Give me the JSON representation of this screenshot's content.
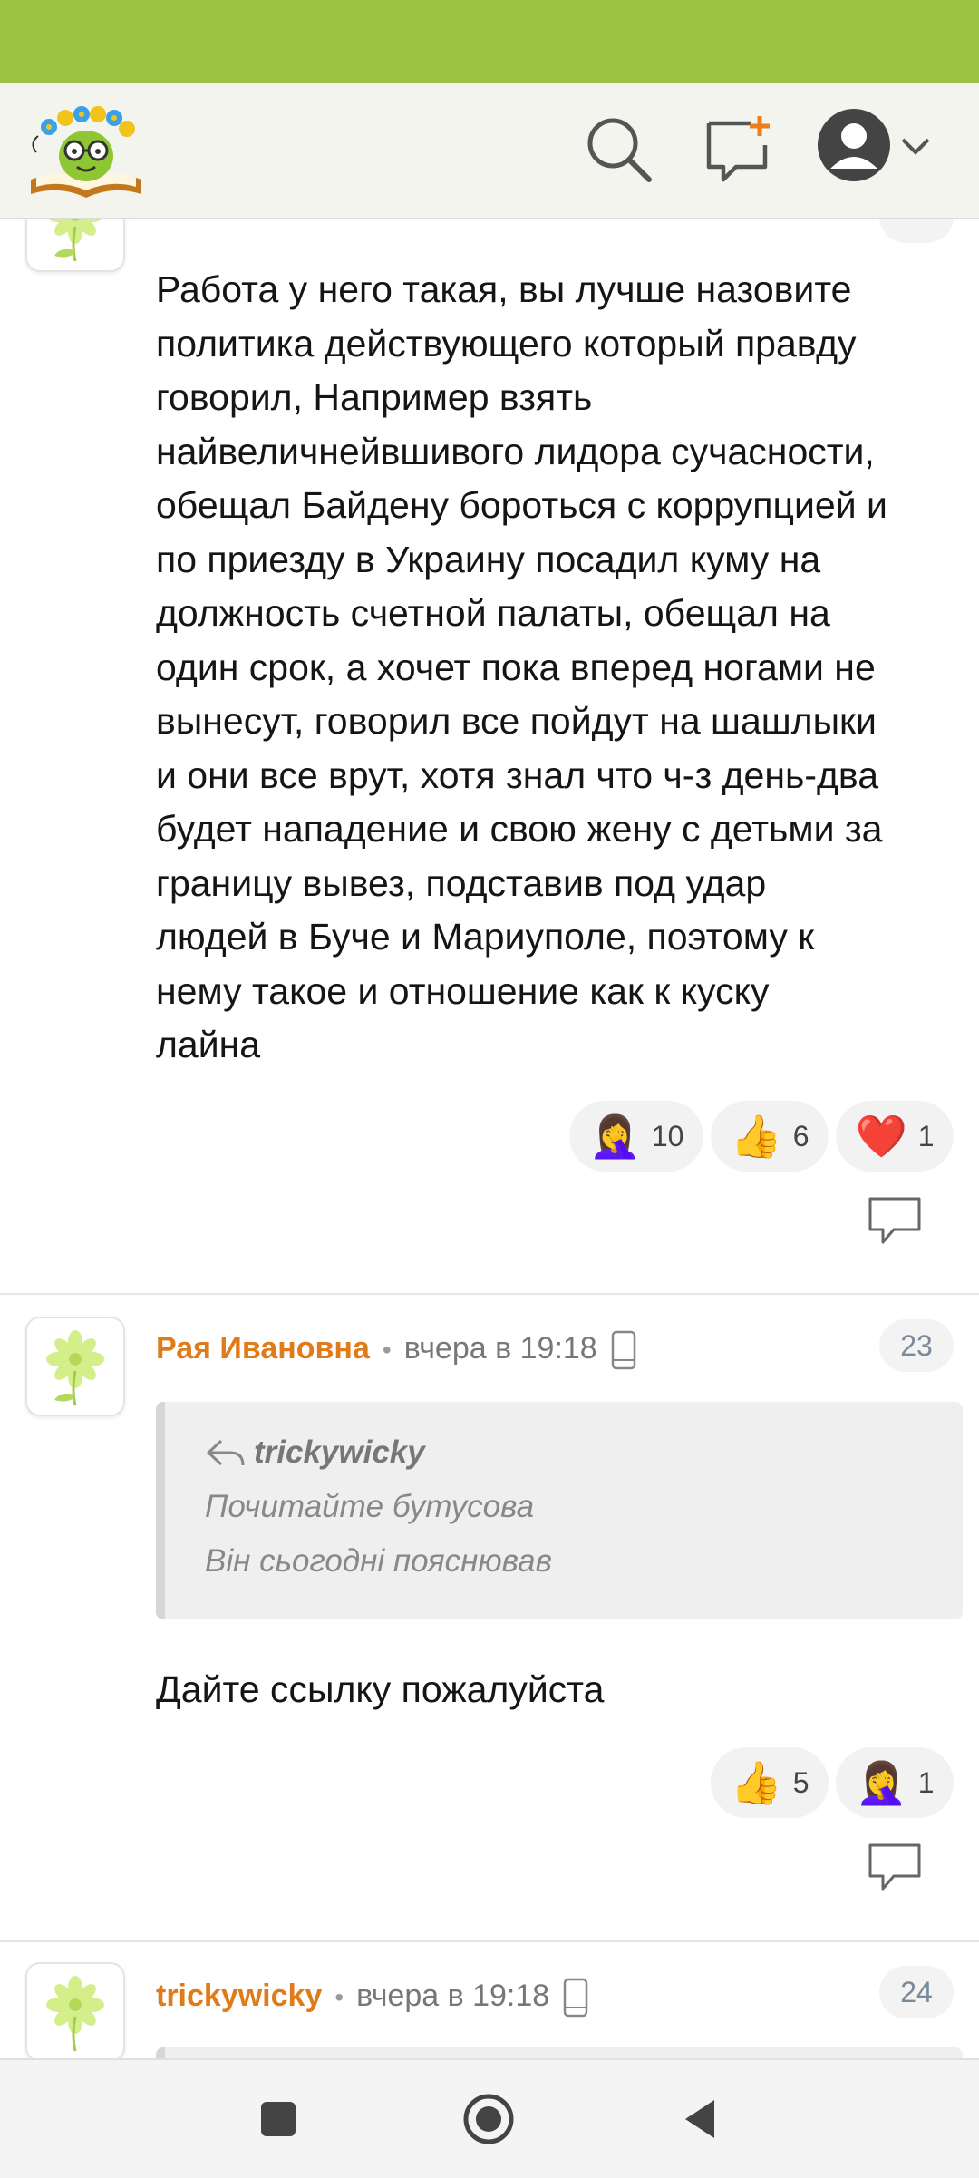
{
  "icons": {
    "search": "search-icon",
    "new_message": "new-message-icon",
    "profile": "user-avatar-icon",
    "menu": "chevron-down-icon",
    "reply": "reply-icon",
    "device": "phone-icon",
    "quote": "quote-arrow-icon"
  },
  "colors": {
    "status_bar": "#9dc243",
    "author": "#e07b1a",
    "badge_text": "#7b8a9b"
  },
  "comments": [
    {
      "text": "Работа у него такая, вы лучше назовите\nполитика действующего который правду\nговорил, Например взять\nнайвеличнейвшивого лидора сучасности,\nобещал Байдену бороться с коррупцией и\nпо приезду в Украину посадил куму на\nдолжность счетной палаты, обещал на\nодин срок, а хочет пока вперед ногами не\nвынесут, говорил все пойдут на шашлыки\nи они все врут, хотя знал что ч-з день-два\nбудет нападение и свою жену с детьми за\nграницу вывез, подставив под удар\nлюдей в Буче и Мариуполе, поэтому к\nнему такое и отношение как к куску\nлайна",
      "reactions": [
        {
          "emoji": "🤦‍♀️",
          "count": "10"
        },
        {
          "emoji": "👍",
          "count": "6"
        },
        {
          "emoji": "❤️",
          "count": "1"
        }
      ]
    },
    {
      "author": "Рая Ивановна",
      "time": "вчера в 19:18",
      "number": "23",
      "quote_author": "trickywicky",
      "quote_lines": [
        "Почитайте бутусова",
        "Він сьогодні пояснював"
      ],
      "text": "Дайте ссылку пожалуйста",
      "reactions": [
        {
          "emoji": "👍",
          "count": "5"
        },
        {
          "emoji": "🤦‍♀️",
          "count": "1"
        }
      ]
    },
    {
      "author": "trickywicky",
      "time": "вчера в 19:18",
      "number": "24"
    }
  ]
}
